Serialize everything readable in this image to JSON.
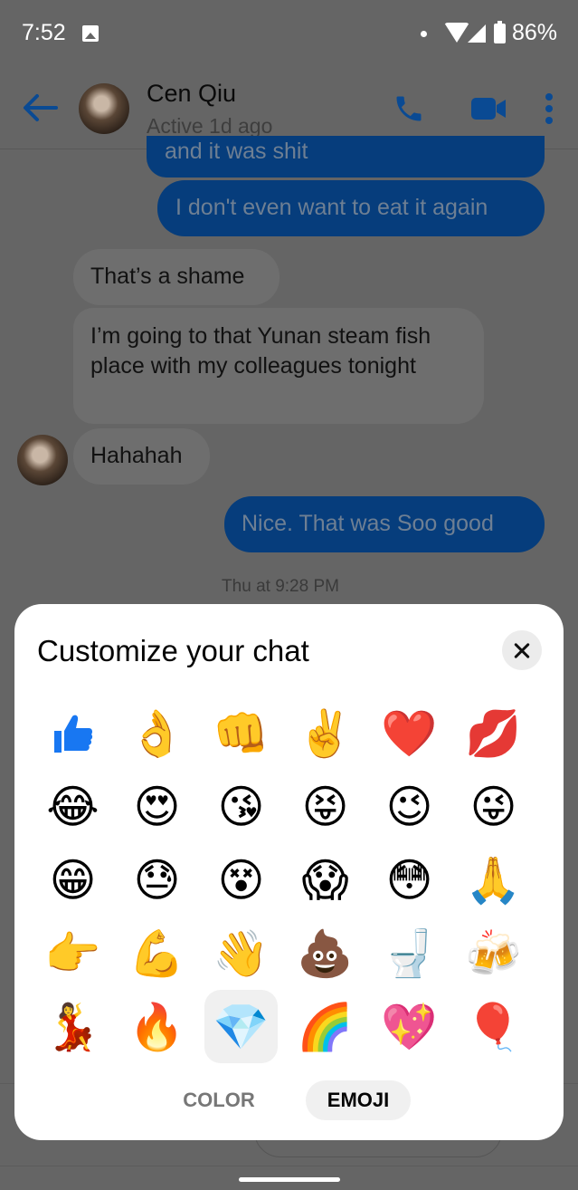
{
  "status_bar": {
    "time": "7:52",
    "battery": "86%",
    "icons": [
      "image-icon",
      "dot-icon",
      "wifi-icon",
      "signal-icon",
      "battery-icon"
    ]
  },
  "header": {
    "contact_name": "Cen Qiu",
    "contact_status": "Active 1d ago",
    "icons": [
      "back-arrow-icon",
      "phone-icon",
      "video-icon",
      "more-vert-icon"
    ],
    "accent_color": "#0a4a93"
  },
  "messages": [
    {
      "direction": "outgoing",
      "text": "and it was shit"
    },
    {
      "direction": "outgoing",
      "text": "I don't even want to eat it again"
    },
    {
      "direction": "incoming",
      "text": "That’s a shame"
    },
    {
      "direction": "incoming",
      "text": "I’m going to that Yunan steam fish place with my colleagues tonight"
    },
    {
      "direction": "incoming",
      "text": "Hahahah"
    },
    {
      "direction": "outgoing",
      "text": "Nice. That was Soo good"
    }
  ],
  "timestamp": "Thu at 9:28 PM",
  "sheet": {
    "title": "Customize your chat",
    "close_icon": "close-icon",
    "emojis": [
      {
        "name": "thumbs-up",
        "glyph": "👍"
      },
      {
        "name": "ok-hand",
        "glyph": "👌"
      },
      {
        "name": "oncoming-fist",
        "glyph": "👊"
      },
      {
        "name": "victory-hand",
        "glyph": "✌️"
      },
      {
        "name": "red-heart",
        "glyph": "❤️"
      },
      {
        "name": "kiss-mark",
        "glyph": "💋"
      },
      {
        "name": "tears-of-joy",
        "glyph": "😂"
      },
      {
        "name": "heart-eyes",
        "glyph": "😍"
      },
      {
        "name": "face-blowing-kiss",
        "glyph": "😘"
      },
      {
        "name": "squinting-tongue",
        "glyph": "😝"
      },
      {
        "name": "winking-face",
        "glyph": "😉"
      },
      {
        "name": "winking-tongue",
        "glyph": "😜"
      },
      {
        "name": "beaming-face",
        "glyph": "😁"
      },
      {
        "name": "downcast-sweat",
        "glyph": "😓"
      },
      {
        "name": "dizzy-face",
        "glyph": "😵"
      },
      {
        "name": "screaming-in-fear",
        "glyph": "😱"
      },
      {
        "name": "flushed-face",
        "glyph": "😳"
      },
      {
        "name": "folded-hands",
        "glyph": "🙏"
      },
      {
        "name": "pointing-right",
        "glyph": "👉"
      },
      {
        "name": "flexed-biceps",
        "glyph": "💪"
      },
      {
        "name": "waving-hand",
        "glyph": "👋"
      },
      {
        "name": "pile-of-poo",
        "glyph": "💩"
      },
      {
        "name": "toilet",
        "glyph": "🚽"
      },
      {
        "name": "clinking-beer-mugs",
        "glyph": "🍻"
      },
      {
        "name": "woman-dancing",
        "glyph": "💃"
      },
      {
        "name": "fire",
        "glyph": "🔥"
      },
      {
        "name": "gem-stone",
        "glyph": "💎",
        "selected": true
      },
      {
        "name": "rainbow",
        "glyph": "🌈"
      },
      {
        "name": "sparkling-heart",
        "glyph": "💖"
      },
      {
        "name": "balloon",
        "glyph": "🎈"
      }
    ],
    "tabs": [
      {
        "label": "COLOR",
        "active": false
      },
      {
        "label": "EMOJI",
        "active": true
      }
    ]
  }
}
